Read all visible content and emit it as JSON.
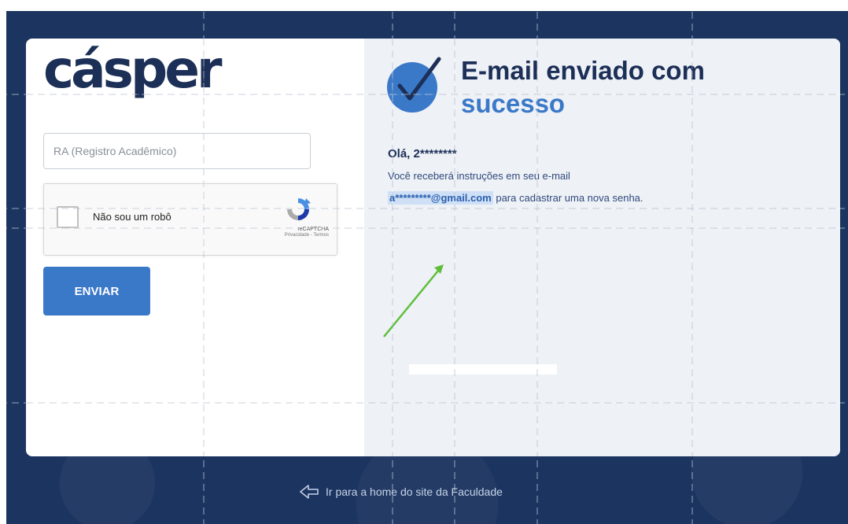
{
  "brand": {
    "logo_text": "cásper"
  },
  "form": {
    "ra_placeholder": "RA (Registro Acadêmico)",
    "captcha": {
      "label": "Não sou um robô",
      "brand": "reCAPTCHA",
      "links": "Privacidade - Termos"
    },
    "submit_label": "ENVIAR"
  },
  "success": {
    "title_line1": "E-mail enviado com",
    "title_line2": "sucesso",
    "greeting": "Olá, 2********",
    "message_line1": "Você receberá instruções em seu e-mail",
    "email_masked": "a*********@gmail.com",
    "message_line2_rest": " para cadastrar uma nova senha."
  },
  "footer": {
    "home_link": "Ir para a home do site da Faculdade"
  },
  "colors": {
    "navy": "#1c2f57",
    "accent_blue": "#3a78c8",
    "background": "#1c3560",
    "annotation_arrow": "#5fbf3a"
  },
  "icons": {
    "check": "check-circle-icon",
    "recaptcha": "recaptcha-icon",
    "home_arrow": "arrow-left-outline-icon"
  }
}
